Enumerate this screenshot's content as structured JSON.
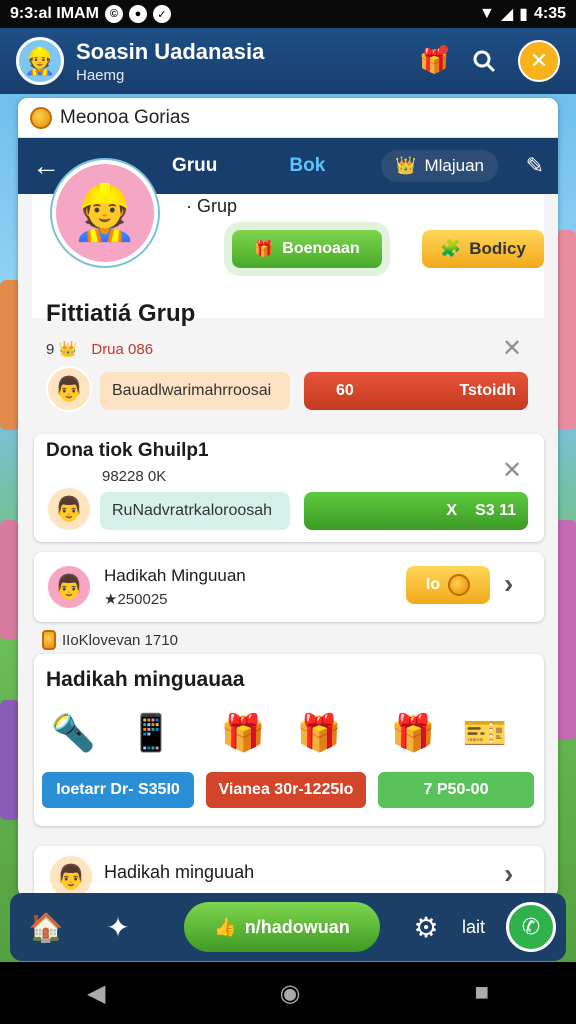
{
  "status_bar": {
    "time": "9:3:al IMAM",
    "battery": "4:35"
  },
  "app_bar": {
    "title": "Soasin Uadanasia",
    "subtitle": "Haemg"
  },
  "panel": {
    "title": "Meonoa Gorias"
  },
  "tabs": [
    {
      "label": "Gruu",
      "active": false
    },
    {
      "label": "Bok",
      "active": true
    },
    {
      "label": "Mlajuan",
      "active": false
    }
  ],
  "profile": {
    "group_label": "· Grup",
    "green_button": "Boenoaan",
    "yellow_button": "Bodicy"
  },
  "section1": {
    "title": "Fittiatiá Grup",
    "meta_left": "9 👑",
    "meta_right": "Drua 086",
    "name_pill": "Bauadlwarimahrroosai",
    "value_left": "60",
    "value_right": "Tstoidh"
  },
  "section2": {
    "title": "Dona tiok Ghuilp1",
    "sub": "98228 0K",
    "name_pill": "RuNadvratrkaloroosah",
    "value_left": "X",
    "value_right": "S3 11"
  },
  "reward_row": {
    "title": "Hadikah Minguuan",
    "stars": "★250025",
    "button": "Io"
  },
  "info_line": "IIoKlovevan 1710",
  "gifts": {
    "title": "Hadikah minguauaa",
    "buttons": [
      {
        "label": "Ioetarr Dr- S35I0",
        "color": "#2b8fd6"
      },
      {
        "label": "Vianea 30r-1225Io",
        "color": "#d2452a"
      },
      {
        "label": "7   P50-00",
        "color": "#59c25a"
      }
    ]
  },
  "last_row": {
    "title": "Hadikah minguuah"
  },
  "bottom_nav": {
    "main_label": "n/hadowuan",
    "side_label": "lait"
  }
}
